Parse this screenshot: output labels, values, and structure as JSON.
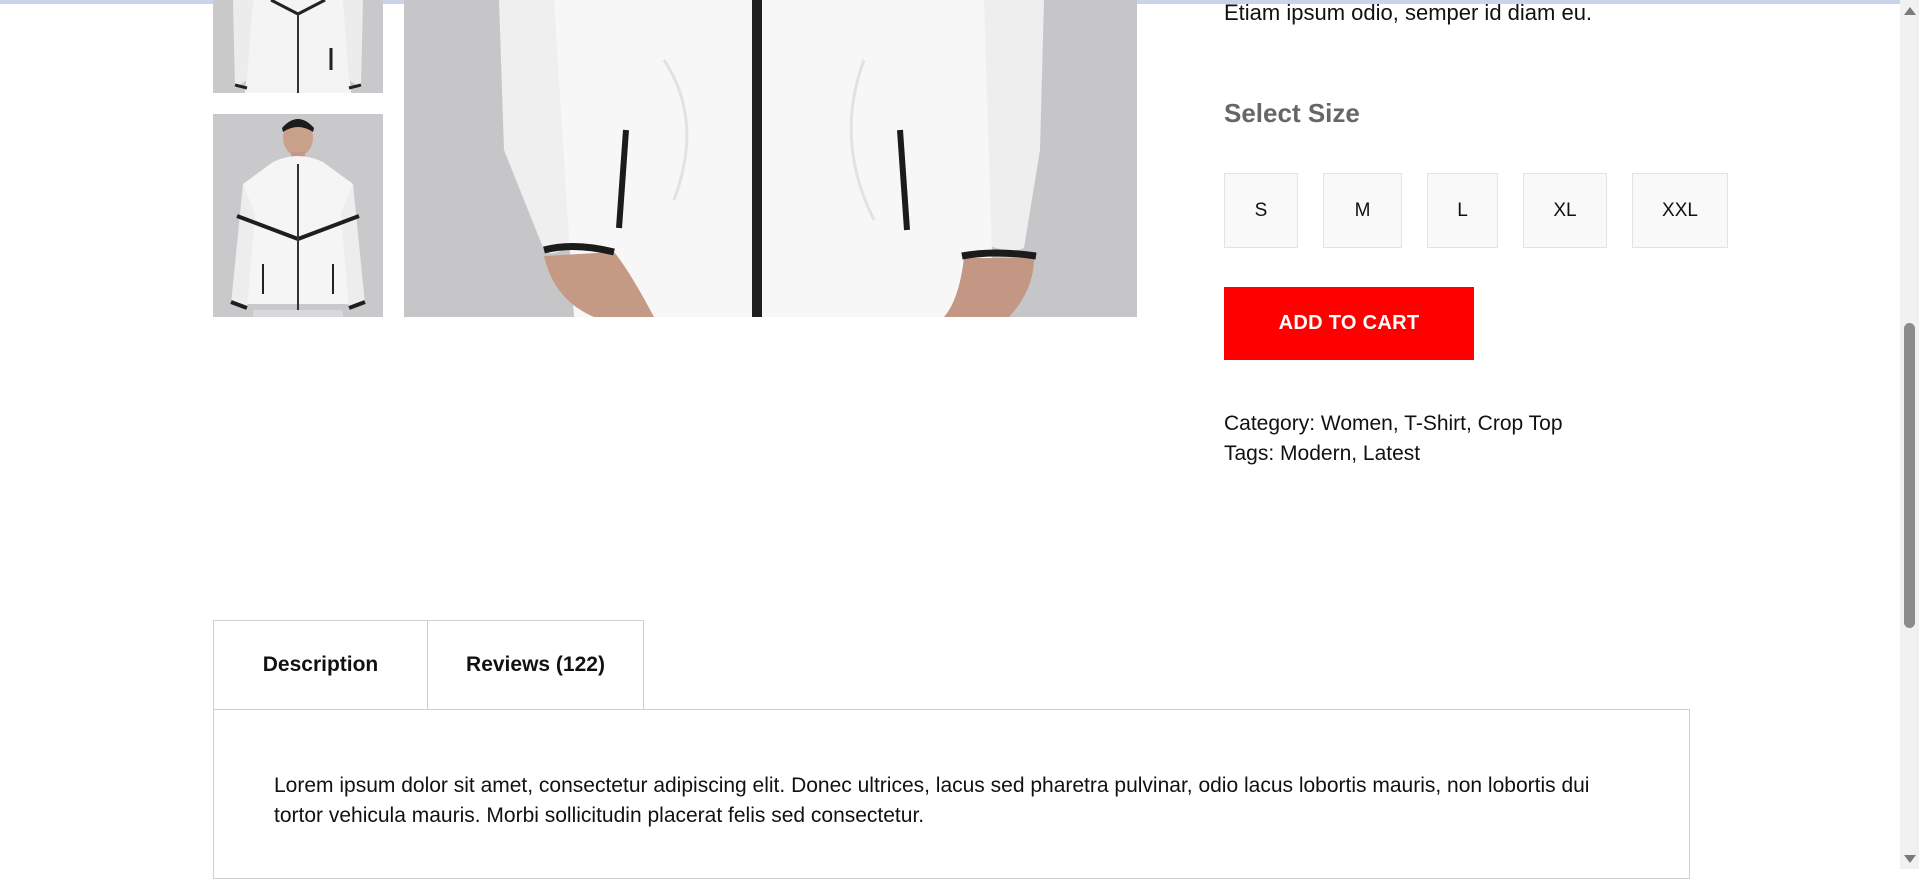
{
  "product": {
    "description_tail": "Etiam ipsum odio, semper id diam eu.",
    "size_title": "Select Size",
    "sizes": [
      "S",
      "M",
      "L",
      "XL",
      "XXL"
    ],
    "add_to_cart_label": "ADD TO CART",
    "category_label": "Category:",
    "category_values": "Women, T-Shirt, Crop Top",
    "tags_label": "Tags:",
    "tags_values": "Modern, Latest"
  },
  "tabs": {
    "items": [
      {
        "label": "Description"
      },
      {
        "label": "Reviews (122)"
      }
    ],
    "description_text": "Lorem ipsum dolor sit amet, consectetur adipiscing elit. Donec ultrices, lacus sed pharetra pulvinar, odio lacus lobortis mauris, non lobortis dui tortor vehicula mauris. Morbi sollicitudin placerat felis sed consectetur."
  },
  "colors": {
    "accent": "#ff0000",
    "size_title": "#666666",
    "border": "#d0d0d0"
  },
  "icons": [
    "scroll-up-arrow-icon",
    "scroll-down-arrow-icon"
  ]
}
